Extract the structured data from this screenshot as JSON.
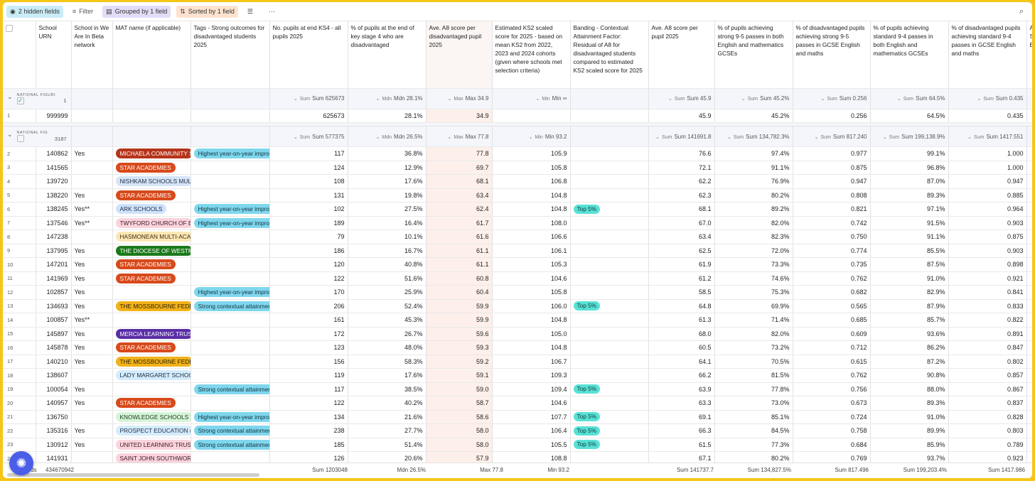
{
  "toolbar": {
    "hidden_fields": "2 hidden fields",
    "filter": "Filter",
    "grouped": "Grouped by 1 field",
    "sorted": "Sorted by 1 field",
    "more": "···"
  },
  "columns": [
    "School URN",
    "School in We Are In Beta network",
    "MAT name (if applicable)",
    "Tags - Strong outcomes for disadvantaged students 2025",
    "No. pupils at end KS4 - all pupils 2025",
    "% of pupils at the end of key stage 4 who are disadvantaged",
    "Ave. A8 score per disadvantaged pupil 2025",
    "Estimated KS2 scaled score for 2025 - based on mean KS2 from 2022, 2023 and 2024 cohorts (given where schools met selection criteria)",
    "Banding - Contextual Attainment Factor: Residual of A8 for disadvantaged students compared to estimated KS2 scaled score for 2025",
    "Ave. A8 score per pupil 2025",
    "% of pupils achieving strong 9-5 passes in both English and mathematics GCSEs",
    "% of disadvantaged pupils achieving strong 9-5 passes in GCSE English and maths",
    "% of pupils achieving standard 9-4 passes in both English and mathematics GCSEs",
    "% of disadvantaged pupils achieving standard 9-4 passes in GCSE English and maths",
    "Av Sc En"
  ],
  "group1": {
    "name": "NATIONAL FIGURI",
    "count": "1",
    "summaries": [
      "Sum 625673",
      "Mdn 28.1%",
      "Max 34.9",
      "Min ∞",
      "",
      "Sum 45.9",
      "Sum 45.2%",
      "Sum 0.256",
      "Sum 64.5%",
      "Sum 0.435"
    ]
  },
  "group1_rows": [
    {
      "n": "1",
      "urn": "999999",
      "beta": "",
      "mat": "",
      "tag": "",
      "pupils": "625673",
      "dis": "28.1%",
      "a8d": "34.9",
      "ks2": "",
      "band": "",
      "a8": "45.9",
      "s95": "45.2%",
      "d95": "0.256",
      "s94": "64.5%",
      "d94": "0.435"
    }
  ],
  "group2": {
    "name": "NATIONAL FIG",
    "count": "3187",
    "summaries": [
      "Sum 577375",
      "Mdn 26.5%",
      "Max 77.8",
      "Min 93.2",
      "",
      "Sum 141691.8",
      "Sum 134,782.3%",
      "Sum 817.240",
      "Sum 199,138.9%",
      "Sum 1417.551"
    ]
  },
  "group2_rows": [
    {
      "n": "2",
      "urn": "140862",
      "beta": "Yes",
      "mat": "MICHAELA COMMUNITY SCHOOLS TRUST",
      "matc": "#b5341a",
      "matt": "#fff",
      "tag": "Highest year-on-year improvement",
      "pupils": "117",
      "dis": "36.8%",
      "a8d": "77.8",
      "ks2": "105.9",
      "band": "",
      "a8": "76.6",
      "s95": "97.4%",
      "d95": "0.977",
      "s94": "99.1%",
      "d94": "1.000"
    },
    {
      "n": "3",
      "urn": "141565",
      "beta": "",
      "mat": "STAR ACADEMIES",
      "matc": "#d84a1b",
      "matt": "#fff",
      "tag": "",
      "pupils": "124",
      "dis": "12.9%",
      "a8d": "69.7",
      "ks2": "105.8",
      "band": "",
      "a8": "72.1",
      "s95": "91.1%",
      "d95": "0.875",
      "s94": "96.8%",
      "d94": "1.000"
    },
    {
      "n": "4",
      "urn": "139720",
      "beta": "",
      "mat": "NISHKAM SCHOOLS MULTI ACADEMY TRUST",
      "matc": "#d6e4f7",
      "matt": "#1f2d44",
      "tag": "",
      "pupils": "108",
      "dis": "17.6%",
      "a8d": "68.1",
      "ks2": "106.8",
      "band": "",
      "a8": "62.2",
      "s95": "76.9%",
      "d95": "0.947",
      "s94": "87.0%",
      "d94": "0.947"
    },
    {
      "n": "5",
      "urn": "138220",
      "beta": "Yes",
      "mat": "STAR ACADEMIES",
      "matc": "#d84a1b",
      "matt": "#fff",
      "tag": "",
      "pupils": "131",
      "dis": "19.8%",
      "a8d": "63.4",
      "ks2": "104.8",
      "band": "",
      "a8": "62.3",
      "s95": "80.2%",
      "d95": "0.808",
      "s94": "89.3%",
      "d94": "0.885"
    },
    {
      "n": "6",
      "urn": "138245",
      "beta": "Yes**",
      "mat": "ARK SCHOOLS",
      "matc": "#cfe2fb",
      "matt": "#1f2d44",
      "tag": "Highest year-on-year improvement",
      "pupils": "102",
      "dis": "27.5%",
      "a8d": "62.4",
      "ks2": "104.8",
      "band": "Top 5%",
      "a8": "68.1",
      "s95": "89.2%",
      "d95": "0.821",
      "s94": "97.1%",
      "d94": "0.964"
    },
    {
      "n": "7",
      "urn": "137546",
      "beta": "Yes**",
      "mat": "TWYFORD CHURCH OF ENGLAND ACADEMIES TRUST",
      "matc": "#fbd3dd",
      "matt": "#3b1a22",
      "tag": "Highest year-on-year improvement",
      "pupils": "189",
      "dis": "16.4%",
      "a8d": "61.7",
      "ks2": "108.0",
      "band": "",
      "a8": "67.0",
      "s95": "82.0%",
      "d95": "0.742",
      "s94": "91.5%",
      "d94": "0.903"
    },
    {
      "n": "8",
      "urn": "147238",
      "beta": "",
      "mat": "HASMONEAN MULTI-ACADEMY TRUST",
      "matc": "#fbe7b4",
      "matt": "#3b2e10",
      "tag": "",
      "pupils": "79",
      "dis": "10.1%",
      "a8d": "61.6",
      "ks2": "106.6",
      "band": "",
      "a8": "63.4",
      "s95": "82.3%",
      "d95": "0.750",
      "s94": "91.1%",
      "d94": "0.875"
    },
    {
      "n": "9",
      "urn": "137995",
      "beta": "Yes",
      "mat": "THE DIOCESE OF WESTMINSTER ACADEMY TRUST",
      "matc": "#1a7a1a",
      "matt": "#fff",
      "tag": "",
      "pupils": "186",
      "dis": "16.7%",
      "a8d": "61.1",
      "ks2": "106.1",
      "band": "",
      "a8": "62.5",
      "s95": "72.0%",
      "d95": "0.774",
      "s94": "85.5%",
      "d94": "0.903"
    },
    {
      "n": "10",
      "urn": "147201",
      "beta": "Yes",
      "mat": "STAR ACADEMIES",
      "matc": "#d84a1b",
      "matt": "#fff",
      "tag": "",
      "pupils": "120",
      "dis": "40.8%",
      "a8d": "61.1",
      "ks2": "105.3",
      "band": "",
      "a8": "61.9",
      "s95": "73.3%",
      "d95": "0.735",
      "s94": "87.5%",
      "d94": "0.898"
    },
    {
      "n": "11",
      "urn": "141969",
      "beta": "Yes",
      "mat": "STAR ACADEMIES",
      "matc": "#d84a1b",
      "matt": "#fff",
      "tag": "",
      "pupils": "122",
      "dis": "51.6%",
      "a8d": "60.8",
      "ks2": "104.6",
      "band": "",
      "a8": "61.2",
      "s95": "74.6%",
      "d95": "0.762",
      "s94": "91.0%",
      "d94": "0.921"
    },
    {
      "n": "12",
      "urn": "102857",
      "beta": "Yes",
      "mat": "",
      "tag": "Highest year-on-year improvement",
      "pupils": "170",
      "dis": "25.9%",
      "a8d": "60.4",
      "ks2": "105.8",
      "band": "",
      "a8": "58.5",
      "s95": "75.3%",
      "d95": "0.682",
      "s94": "82.9%",
      "d94": "0.841"
    },
    {
      "n": "13",
      "urn": "134693",
      "beta": "Yes",
      "mat": "THE MOSSBOURNE FEDERATION",
      "matc": "#f2b21a",
      "matt": "#2a1f00",
      "tag": "Strong contextual attainment",
      "pupils": "206",
      "dis": "52.4%",
      "a8d": "59.9",
      "ks2": "106.0",
      "band": "Top 5%",
      "a8": "64.8",
      "s95": "69.9%",
      "d95": "0.565",
      "s94": "87.9%",
      "d94": "0.833"
    },
    {
      "n": "14",
      "urn": "100857",
      "beta": "Yes**",
      "mat": "",
      "tag": "",
      "pupils": "161",
      "dis": "45.3%",
      "a8d": "59.9",
      "ks2": "104.8",
      "band": "",
      "a8": "61.3",
      "s95": "71.4%",
      "d95": "0.685",
      "s94": "85.7%",
      "d94": "0.822"
    },
    {
      "n": "15",
      "urn": "145897",
      "beta": "Yes",
      "mat": "MERCIA LEARNING TRUST",
      "matc": "#5a2ea6",
      "matt": "#fff",
      "tag": "",
      "pupils": "172",
      "dis": "26.7%",
      "a8d": "59.6",
      "ks2": "105.0",
      "band": "",
      "a8": "68.0",
      "s95": "82.0%",
      "d95": "0.609",
      "s94": "93.6%",
      "d94": "0.891"
    },
    {
      "n": "16",
      "urn": "145878",
      "beta": "Yes",
      "mat": "STAR ACADEMIES",
      "matc": "#d84a1b",
      "matt": "#fff",
      "tag": "",
      "pupils": "123",
      "dis": "48.0%",
      "a8d": "59.3",
      "ks2": "104.8",
      "band": "",
      "a8": "60.5",
      "s95": "73.2%",
      "d95": "0.712",
      "s94": "86.2%",
      "d94": "0.847"
    },
    {
      "n": "17",
      "urn": "140210",
      "beta": "Yes",
      "mat": "THE MOSSBOURNE FEDERATION",
      "matc": "#f2b21a",
      "matt": "#2a1f00",
      "tag": "",
      "pupils": "156",
      "dis": "58.3%",
      "a8d": "59.2",
      "ks2": "106.7",
      "band": "",
      "a8": "64.1",
      "s95": "70.5%",
      "d95": "0.615",
      "s94": "87.2%",
      "d94": "0.802"
    },
    {
      "n": "18",
      "urn": "138607",
      "beta": "",
      "mat": "LADY MARGARET SCHOOL",
      "matc": "#d4ecfb",
      "matt": "#1f2d44",
      "tag": "",
      "pupils": "119",
      "dis": "17.6%",
      "a8d": "59.1",
      "ks2": "109.3",
      "band": "",
      "a8": "66.2",
      "s95": "81.5%",
      "d95": "0.762",
      "s94": "90.8%",
      "d94": "0.857"
    },
    {
      "n": "19",
      "urn": "100054",
      "beta": "Yes",
      "mat": "",
      "tag": "Strong contextual attainment",
      "pupils": "117",
      "dis": "38.5%",
      "a8d": "59.0",
      "ks2": "109.4",
      "band": "Top 5%",
      "a8": "63.9",
      "s95": "77.8%",
      "d95": "0.756",
      "s94": "88.0%",
      "d94": "0.867"
    },
    {
      "n": "20",
      "urn": "140957",
      "beta": "Yes",
      "mat": "STAR ACADEMIES",
      "matc": "#d84a1b",
      "matt": "#fff",
      "tag": "",
      "pupils": "122",
      "dis": "40.2%",
      "a8d": "58.7",
      "ks2": "104.6",
      "band": "",
      "a8": "63.3",
      "s95": "73.0%",
      "d95": "0.673",
      "s94": "89.3%",
      "d94": "0.837"
    },
    {
      "n": "21",
      "urn": "136750",
      "beta": "",
      "mat": "KNOWLEDGE SCHOOLS TRUST",
      "matc": "#d6f4d8",
      "matt": "#1a3a1d",
      "tag": "Highest year-on-year improvement",
      "pupils": "134",
      "dis": "21.6%",
      "a8d": "58.6",
      "ks2": "107.7",
      "band": "Top 5%",
      "a8": "69.1",
      "s95": "85.1%",
      "d95": "0.724",
      "s94": "91.0%",
      "d94": "0.828"
    },
    {
      "n": "22",
      "urn": "135316",
      "beta": "Yes",
      "mat": "PROSPECT EDUCATION (TECHNOLOGY) TRUST",
      "matc": "#d4ecfb",
      "matt": "#1f2d44",
      "tag": "Strong contextual attainment",
      "pupils": "238",
      "dis": "27.7%",
      "a8d": "58.0",
      "ks2": "106.4",
      "band": "Top 5%",
      "a8": "66.3",
      "s95": "84.5%",
      "d95": "0.758",
      "s94": "89.9%",
      "d94": "0.803"
    },
    {
      "n": "23",
      "urn": "130912",
      "beta": "Yes",
      "mat": "UNITED LEARNING TRUST",
      "matc": "#fbd3dd",
      "matt": "#3b1a22",
      "tag": "Strong contextual attainment",
      "pupils": "185",
      "dis": "51.4%",
      "a8d": "58.0",
      "ks2": "105.5",
      "band": "Top 5%",
      "a8": "61.5",
      "s95": "77.3%",
      "d95": "0.684",
      "s94": "85.9%",
      "d94": "0.789"
    },
    {
      "n": "24",
      "urn": "141931",
      "beta": "",
      "mat": "SAINT JOHN SOUTHWORTH",
      "matc": "#fbd3dd",
      "matt": "#3b1a22",
      "tag": "",
      "pupils": "126",
      "dis": "20.6%",
      "a8d": "57.9",
      "ks2": "108.8",
      "band": "",
      "a8": "67.1",
      "s95": "80.2%",
      "d95": "0.769",
      "s94": "93.7%",
      "d94": "0.923"
    }
  ],
  "footer": {
    "records": "ords",
    "urn_sum": "434670942",
    "pupils": "Sum 1203048",
    "dis": "Mdn 26.5%",
    "a8d": "Max 77.8",
    "ks2": "Min 93.2",
    "a8": "Sum 141737.7",
    "s95": "Sum 134,827.5%",
    "d95": "Sum 817.496",
    "s94": "Sum 199,203.4%",
    "d94": "Sum 1417.986"
  }
}
